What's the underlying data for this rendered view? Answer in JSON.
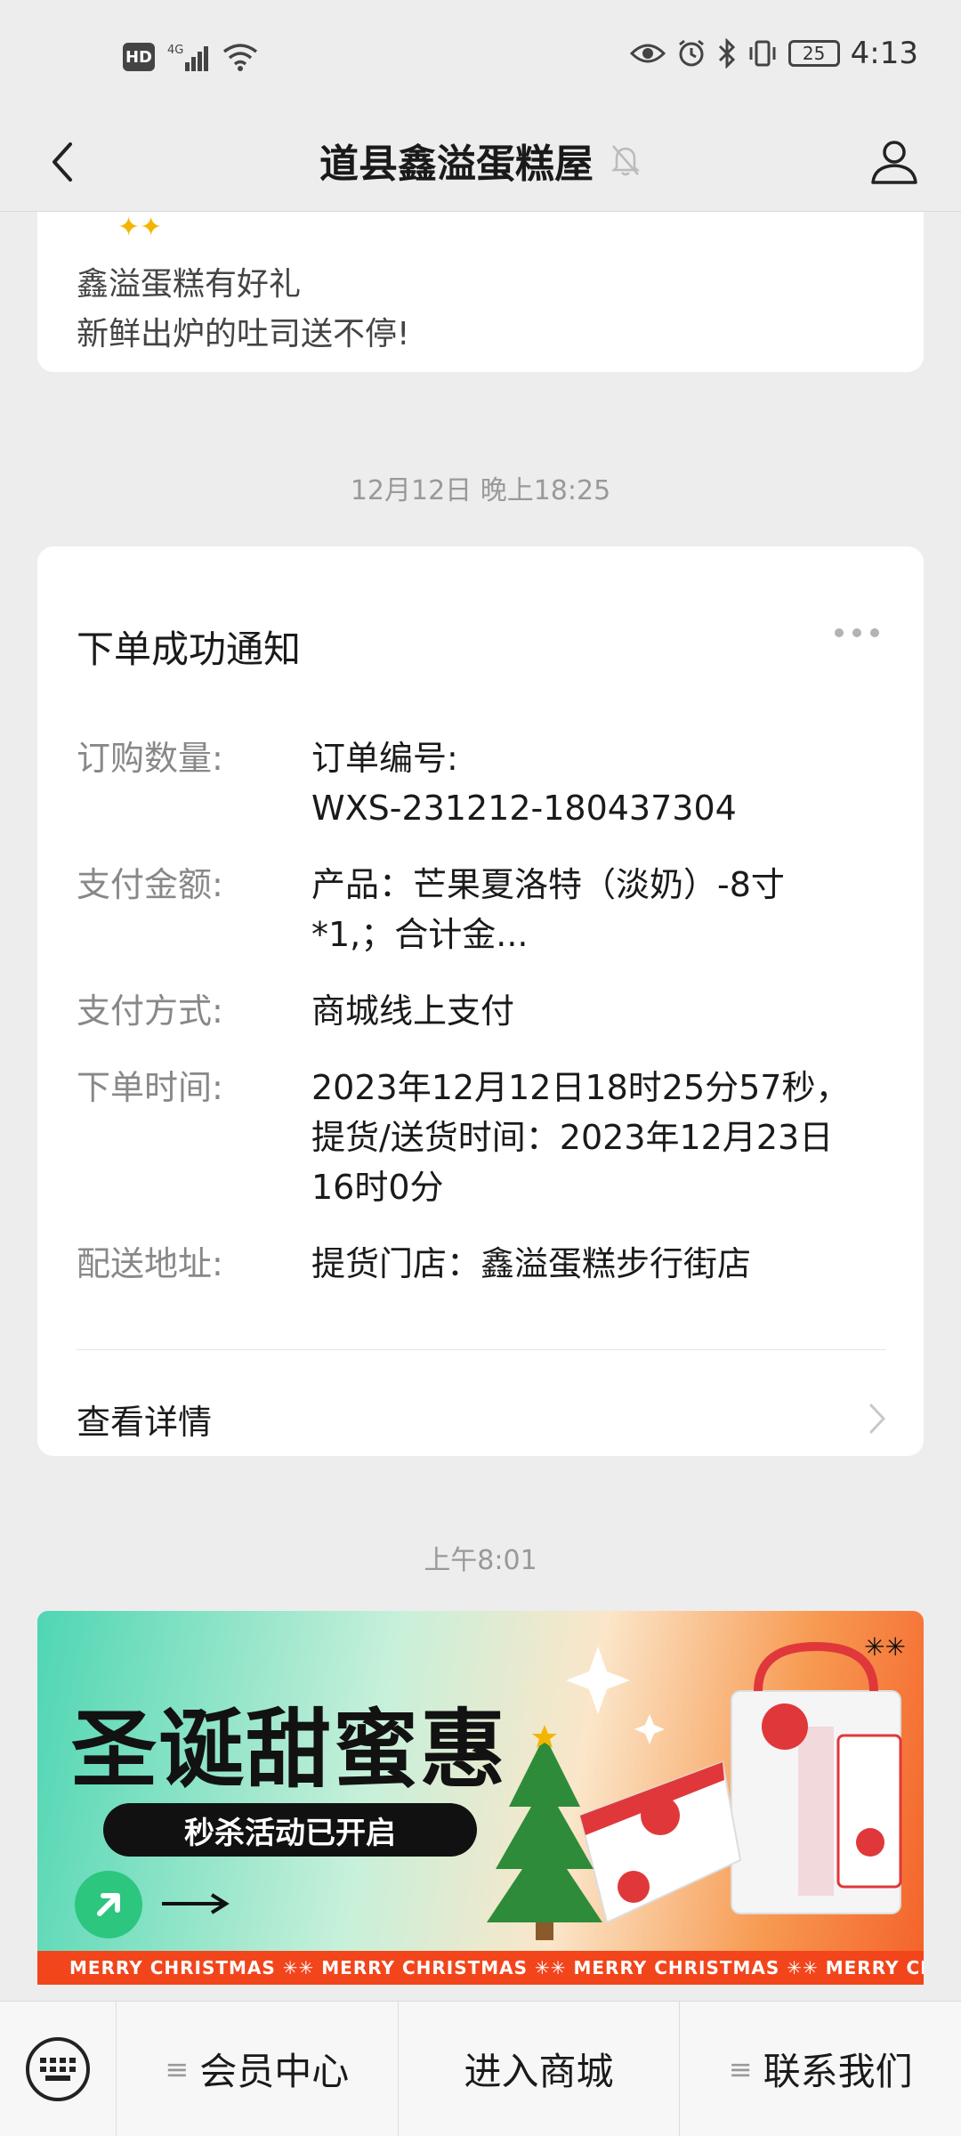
{
  "status_bar": {
    "left_badge": "HD",
    "network": "4G",
    "battery": "25",
    "time": "4:13"
  },
  "nav": {
    "title": "道县鑫溢蛋糕屋"
  },
  "prev_message": {
    "line1": "鑫溢蛋糕有好礼",
    "line2": "新鲜出炉的吐司送不停!"
  },
  "timestamps": {
    "t1": "12月12日 晚上18:25",
    "t2": "上午8:01"
  },
  "order_card": {
    "title": "下单成功通知",
    "fields": [
      {
        "label": "订购数量:",
        "value": "订单编号:\nWXS-231212-180437304"
      },
      {
        "label": "支付金额:",
        "value": "产品：芒果夏洛特（淡奶）-8寸\n*1,；合计金..."
      },
      {
        "label": "支付方式:",
        "value": "商城线上支付"
      },
      {
        "label": "下单时间:",
        "value": "2023年12月12日18时25分57秒，\n提货/送货时间：2023年12月23日\n16时0分"
      },
      {
        "label": "配送地址:",
        "value": "提货门店：鑫溢蛋糕步行街店"
      }
    ],
    "detail_label": "查看详情"
  },
  "banner": {
    "title": "圣诞甜蜜惠",
    "pill": "秒杀活动已开启",
    "ticker": "MERRY CHRISTMAS ✳✳ MERRY CHRISTMAS ✳✳ MERRY CHRISTMAS ✳✳ MERRY CH"
  },
  "bottom_menu": {
    "items": [
      {
        "label": "会员中心"
      },
      {
        "label": "进入商城"
      },
      {
        "label": "联系我们"
      }
    ]
  }
}
